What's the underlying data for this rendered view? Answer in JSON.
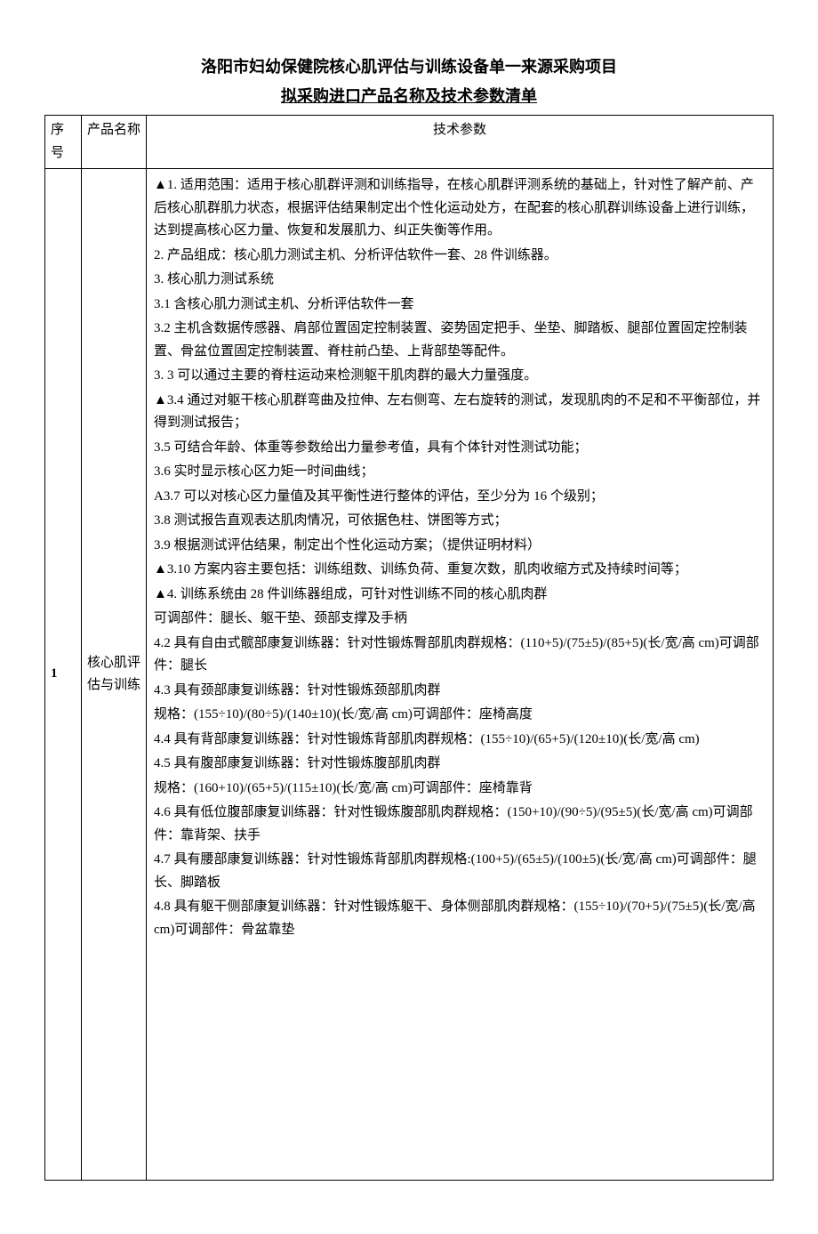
{
  "title": "洛阳市妇幼保健院核心肌评估与训练设备单一来源采购项目",
  "subtitle": "拟采购进口产品名称及技术参数清单",
  "headers": {
    "seq": "序号",
    "name": "产品名称",
    "param": "技术参数"
  },
  "row": {
    "seq": "1",
    "name": "核心肌评估与训练",
    "params": [
      "▲1. 适用范围：适用于核心肌群评测和训练指导，在核心肌群评测系统的基础上，针对性了解产前、产后核心肌群肌力状态，根据评估结果制定出个性化运动处方，在配套的核心肌群训练设备上进行训练，达到提高核心区力量、恢复和发展肌力、纠正失衡等作用。",
      "2. 产品组成：核心肌力测试主机、分析评估软件一套、28 件训练器。",
      "3. 核心肌力测试系统",
      "3.1  含核心肌力测试主机、分析评估软件一套",
      "3.2  主机含数据传感器、肩部位置固定控制装置、姿势固定把手、坐垫、脚踏板、腿部位置固定控制装置、骨盆位置固定控制装置、脊柱前凸垫、上背部垫等配件。",
      "3. 3 可以通过主要的脊柱运动来检测躯干肌肉群的最大力量强度。",
      "▲3.4 通过对躯干核心肌群弯曲及拉伸、左右侧弯、左右旋转的测试，发现肌肉的不足和不平衡部位，并得到测试报告；",
      "3.5 可结合年龄、体重等参数给出力量参考值，具有个体针对性测试功能；",
      "3.6 实时显示核心区力矩一时间曲线；",
      "A3.7 可以对核心区力量值及其平衡性进行整体的评估，至少分为 16 个级别；",
      "3.8 测试报告直观表达肌肉情况，可依据色柱、饼图等方式；",
      "3.9 根据测试评估结果，制定出个性化运动方案；（提供证明材料）",
      "▲3.10 方案内容主要包括：训练组数、训练负荷、重复次数，肌肉收缩方式及持续时间等；",
      "▲4. 训练系统由 28 件训练器组成，可针对性训练不同的核心肌肉群",
      "可调部件：腿长、躯干垫、颈部支撑及手柄",
      "4.2 具有自由式髋部康复训练器：针对性锻炼臀部肌肉群规格：(110+5)/(75±5)/(85+5)(长/宽/高 cm)可调部件：腿长",
      "4.3 具有颈部康复训练器：针对性锻炼颈部肌肉群",
      "规格：(155÷10)/(80÷5)/(140±10)(长/宽/高 cm)可调部件：座椅高度",
      "4.4 具有背部康复训练器：针对性锻炼背部肌肉群规格：(155÷10)/(65+5)/(120±10)(长/宽/高 cm)",
      "4.5 具有腹部康复训练器：针对性锻炼腹部肌肉群",
      "规格：(160+10)/(65+5)/(115±10)(长/宽/高 cm)可调部件：座椅靠背",
      "4.6 具有低位腹部康复训练器：针对性锻炼腹部肌肉群规格：(150+10)/(90÷5)/(95±5)(长/宽/高 cm)可调部件：靠背架、扶手",
      "4.7 具有腰部康复训练器：针对性锻炼背部肌肉群规格:(100+5)/(65±5)/(100±5)(长/宽/高 cm)可调部件：腿长、脚踏板",
      "4.8 具有躯干侧部康复训练器：针对性锻炼躯干、身体侧部肌肉群规格：(155÷10)/(70+5)/(75±5)(长/宽/高 cm)可调部件：骨盆靠垫"
    ]
  }
}
